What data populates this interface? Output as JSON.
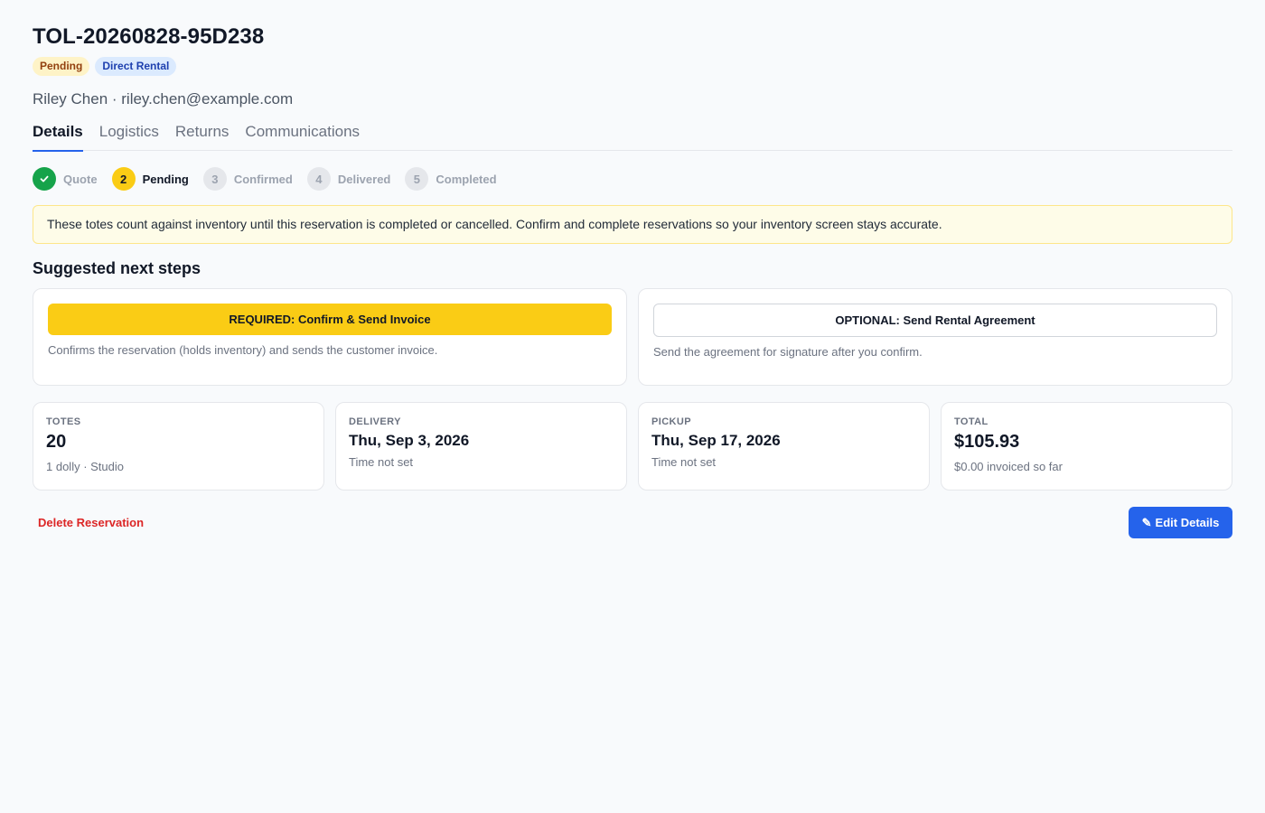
{
  "header": {
    "title": "TOL-20260828-95D238",
    "badges": {
      "status": "Pending",
      "type": "Direct Rental"
    },
    "customer": "Riley Chen · riley.chen@example.com"
  },
  "tabs": [
    "Details",
    "Logistics",
    "Returns",
    "Communications"
  ],
  "stepper": [
    {
      "number": "1",
      "label": "Quote",
      "state": "done",
      "icon": "check-icon"
    },
    {
      "number": "2",
      "label": "Pending",
      "state": "current"
    },
    {
      "number": "3",
      "label": "Confirmed",
      "state": "todo"
    },
    {
      "number": "4",
      "label": "Delivered",
      "state": "todo"
    },
    {
      "number": "5",
      "label": "Completed",
      "state": "todo"
    }
  ],
  "notice": "These totes count against inventory until this reservation is completed or cancelled. Confirm and complete reservations so your inventory screen stays accurate.",
  "next_steps": {
    "title": "Suggested next steps",
    "required": {
      "button": "REQUIRED: Confirm & Send Invoice",
      "description": "Confirms the reservation (holds inventory) and sends the customer invoice."
    },
    "optional": {
      "button": "OPTIONAL: Send Rental Agreement",
      "description": "Send the agreement for signature after you confirm."
    }
  },
  "stats": {
    "totes": {
      "label": "TOTES",
      "value": "20",
      "sub": "1 dolly · Studio"
    },
    "delivery": {
      "label": "DELIVERY",
      "value": "Thu, Sep 3, 2026",
      "sub": "Time not set"
    },
    "pickup": {
      "label": "PICKUP",
      "value": "Thu, Sep 17, 2026",
      "sub": "Time not set"
    },
    "total": {
      "label": "TOTAL",
      "value": "$105.93",
      "sub": "$0.00 invoiced so far"
    }
  },
  "actions": {
    "delete": "Delete Reservation",
    "edit": "Edit Details",
    "edit_icon": "pencil-icon"
  },
  "colors": {
    "accent": "#2563eb",
    "required": "#facc15",
    "success": "#16a34a",
    "danger": "#dc2626"
  }
}
